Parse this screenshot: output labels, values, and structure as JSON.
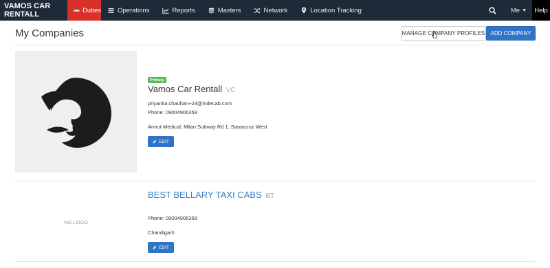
{
  "navbar": {
    "brand": "VAMOS CAR RENTALL",
    "items": [
      {
        "label": "Duties",
        "icon": "minus-icon",
        "active": true
      },
      {
        "label": "Operations",
        "icon": "list-icon"
      },
      {
        "label": "Reports",
        "icon": "chart-line-icon"
      },
      {
        "label": "Masters",
        "icon": "database-icon"
      },
      {
        "label": "Network",
        "icon": "shuffle-icon"
      },
      {
        "label": "Location Tracking",
        "icon": "map-marker-icon"
      }
    ],
    "me_label": "Me",
    "help_label": "Help"
  },
  "header": {
    "title": "My Companies",
    "manage_label": "MANAGE COMPANY PROFILES",
    "add_label": "ADD COMPANY"
  },
  "companies": [
    {
      "badge": "Primary",
      "name": "Vamos Car Rentall",
      "code": "VC",
      "email": "priyanka.chauhan+24@indecab.com",
      "phone": "Phone: 09004906358",
      "address": "Amrut Medical, Milan Subway Rd 1, Santacruz West",
      "edit_label": "EDIT"
    },
    {
      "name": "BEST BELLARY TAXI CABS",
      "code": "BT",
      "no_logo": "NO LOGO",
      "phone": "Phone: 09004906358",
      "address": "Chandigarh",
      "edit_label": "EDIT"
    }
  ],
  "colors": {
    "navbar": "#1f2a38",
    "active": "#d9302c",
    "primary": "#2f74c6",
    "badge": "#5cb85c",
    "link": "#3a7fc4"
  }
}
